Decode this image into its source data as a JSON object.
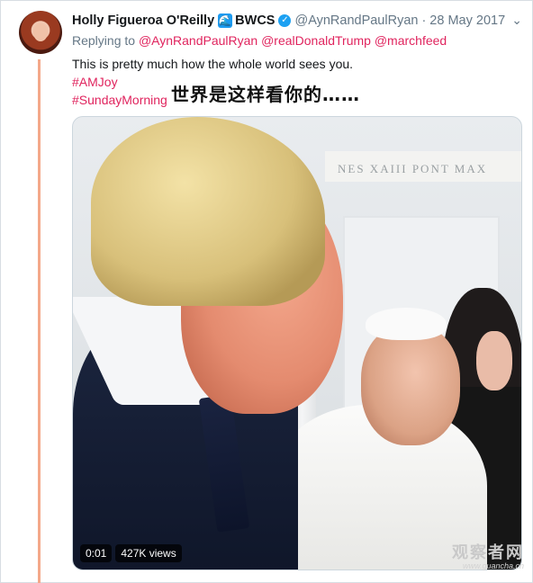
{
  "tweet": {
    "author_name": "Holly Figueroa O'Reilly",
    "group_label": "BWCS",
    "wave_glyph": "🌊",
    "verified_glyph": "✓",
    "handle": "@AynRandPaulRyan",
    "separator": "·",
    "date": "28 May 2017",
    "more_glyph": "⌄",
    "replying_prefix": "Replying to",
    "replying_to": [
      "@AynRandPaulRyan",
      "@realDonaldTrump",
      "@marchfeed"
    ],
    "text": "This is pretty much how the whole world sees you.",
    "hashtags": [
      "#AMJoy",
      "#SundayMorning"
    ],
    "overlay_caption": "世界是这样看你的……"
  },
  "video": {
    "plaque_text": "NES XAIII PONT MAX",
    "time": "0:01",
    "views": "427K views"
  },
  "watermark": {
    "main": "观察者网",
    "sub": "www.guancha.cn"
  },
  "colors": {
    "hashtag": "#e0245e",
    "thread_line": "#f4a88a",
    "muted": "#657786",
    "verified": "#1da1f2"
  },
  "icons": {
    "wave": "wave-icon",
    "verified": "verified-badge-icon",
    "more": "chevron-down-icon"
  }
}
